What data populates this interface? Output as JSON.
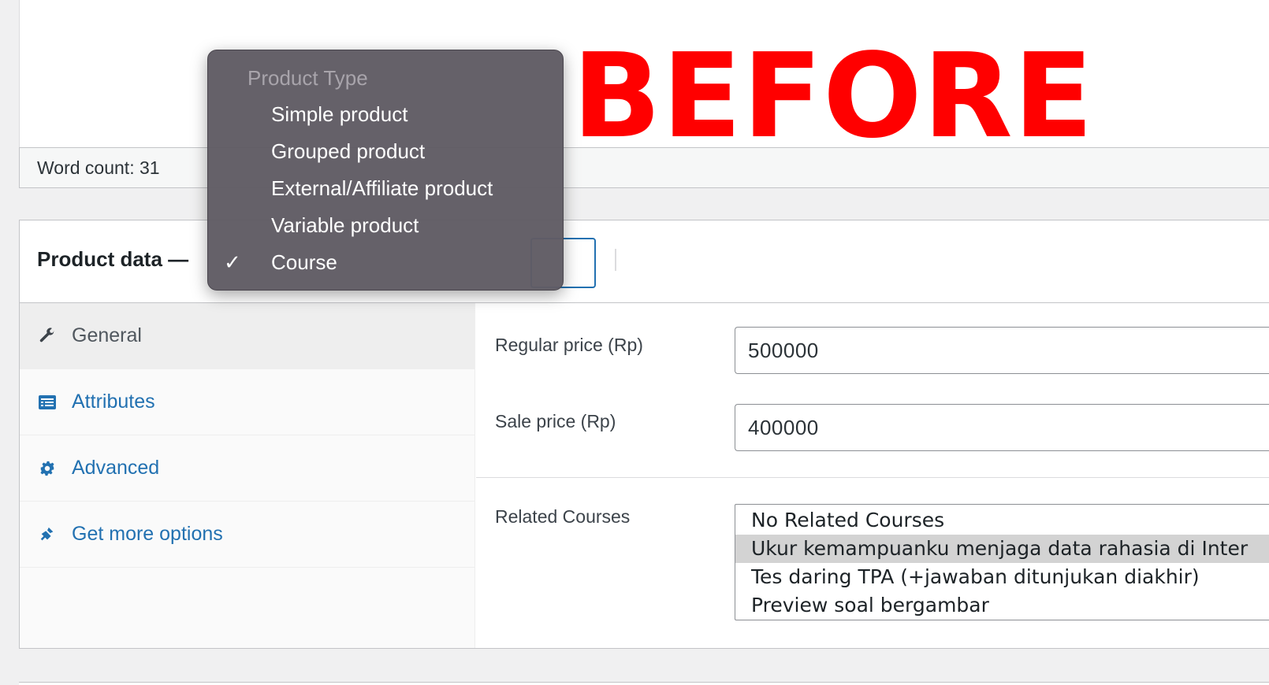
{
  "banner": {
    "text": "BEFORE"
  },
  "editor": {
    "word_count": "Word count: 31"
  },
  "product_data": {
    "title": "Product data —",
    "product_type_menu": {
      "header": "Product Type",
      "options": [
        {
          "label": "Simple product",
          "checked": false
        },
        {
          "label": "Grouped product",
          "checked": false
        },
        {
          "label": "External/Affiliate product",
          "checked": false
        },
        {
          "label": "Variable product",
          "checked": false
        },
        {
          "label": "Course",
          "checked": true
        }
      ],
      "check_mark": "✓"
    },
    "tabs": [
      {
        "label": "General",
        "icon": "wrench-icon",
        "active": true
      },
      {
        "label": "Attributes",
        "icon": "list-icon",
        "active": false
      },
      {
        "label": "Advanced",
        "icon": "gear-icon",
        "active": false
      },
      {
        "label": "Get more options",
        "icon": "plugin-icon",
        "active": false
      }
    ],
    "fields": {
      "regular_price": {
        "label": "Regular price (Rp)",
        "value": "500000"
      },
      "sale_price": {
        "label": "Sale price (Rp)",
        "value": "400000"
      },
      "related_courses": {
        "label": "Related Courses",
        "options": [
          {
            "label": "No Related Courses",
            "selected": false
          },
          {
            "label": "Ukur kemampuanku menjaga data rahasia di Inter",
            "selected": true
          },
          {
            "label": "Tes daring TPA (+jawaban ditunjukan diakhir)",
            "selected": false
          },
          {
            "label": "Preview soal bergambar",
            "selected": false
          }
        ]
      }
    }
  },
  "colors": {
    "accent": "#2271b1",
    "banner": "#ff0000",
    "popup_bg": "#605c64"
  }
}
